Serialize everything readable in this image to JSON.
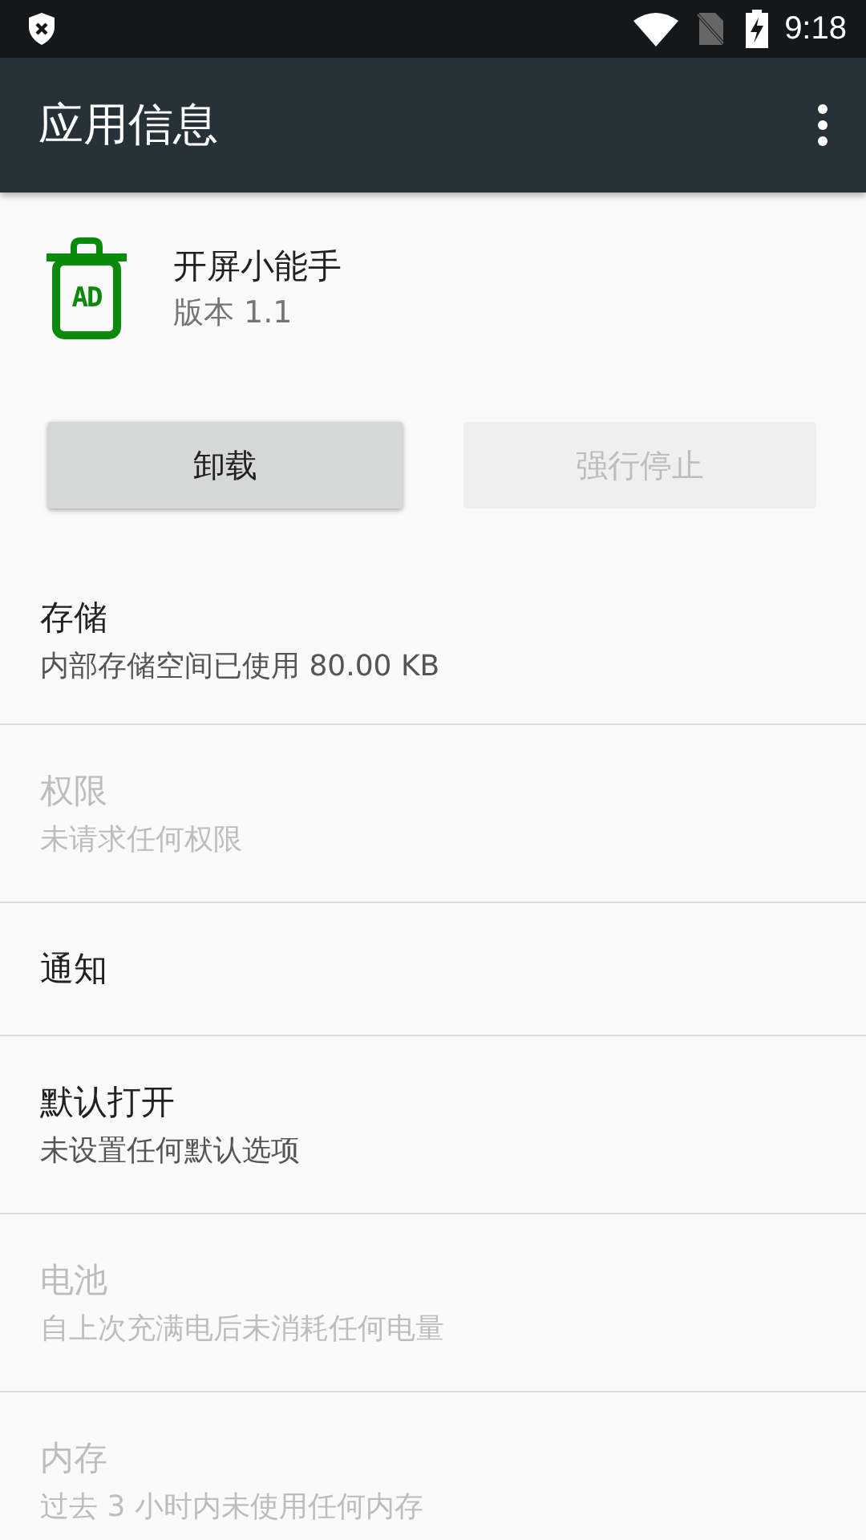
{
  "status_bar": {
    "time": "9:18"
  },
  "toolbar": {
    "title": "应用信息"
  },
  "app": {
    "icon_text": "AD",
    "name": "开屏小能手",
    "version": "版本 1.1"
  },
  "buttons": [
    {
      "label": "卸载",
      "disabled": false
    },
    {
      "label": "强行停止",
      "disabled": true
    }
  ],
  "settings": [
    {
      "title": "存储",
      "summary": "内部存储空间已使用 80.00 KB",
      "disabled": false
    },
    {
      "title": "权限",
      "summary": "未请求任何权限",
      "disabled": true
    },
    {
      "title": "通知",
      "disabled": false
    },
    {
      "title": "默认打开",
      "summary": "未设置任何默认选项",
      "disabled": false
    },
    {
      "title": "电池",
      "summary": "自上次充满电后未消耗任何电量",
      "disabled": true
    },
    {
      "title": "内存",
      "summary": "过去 3 小时内未使用任何内存",
      "disabled": true
    }
  ]
}
